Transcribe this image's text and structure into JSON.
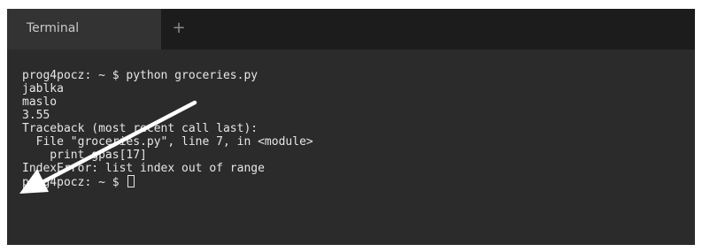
{
  "tabs": {
    "terminal_label": "Terminal",
    "new_tab_label": "+"
  },
  "terminal": {
    "lines": [
      "prog4pocz: ~ $ python groceries.py",
      "jablka",
      "maslo",
      "3.55",
      "Traceback (most recent call last):",
      "  File \"groceries.py\", line 7, in <module>",
      "    print gpas[17]",
      "IndexError: list index out of range"
    ],
    "prompt": "prog4pocz: ~ $ "
  },
  "annotation": {
    "arrow_color": "#ffffff",
    "arrow_icon": "arrow-annotation-icon"
  },
  "colors": {
    "terminal_bg": "#2b2b2b",
    "tabbar_bg": "#1c1c1c",
    "active_tab_bg": "#333333",
    "text": "#e6e6e6"
  }
}
